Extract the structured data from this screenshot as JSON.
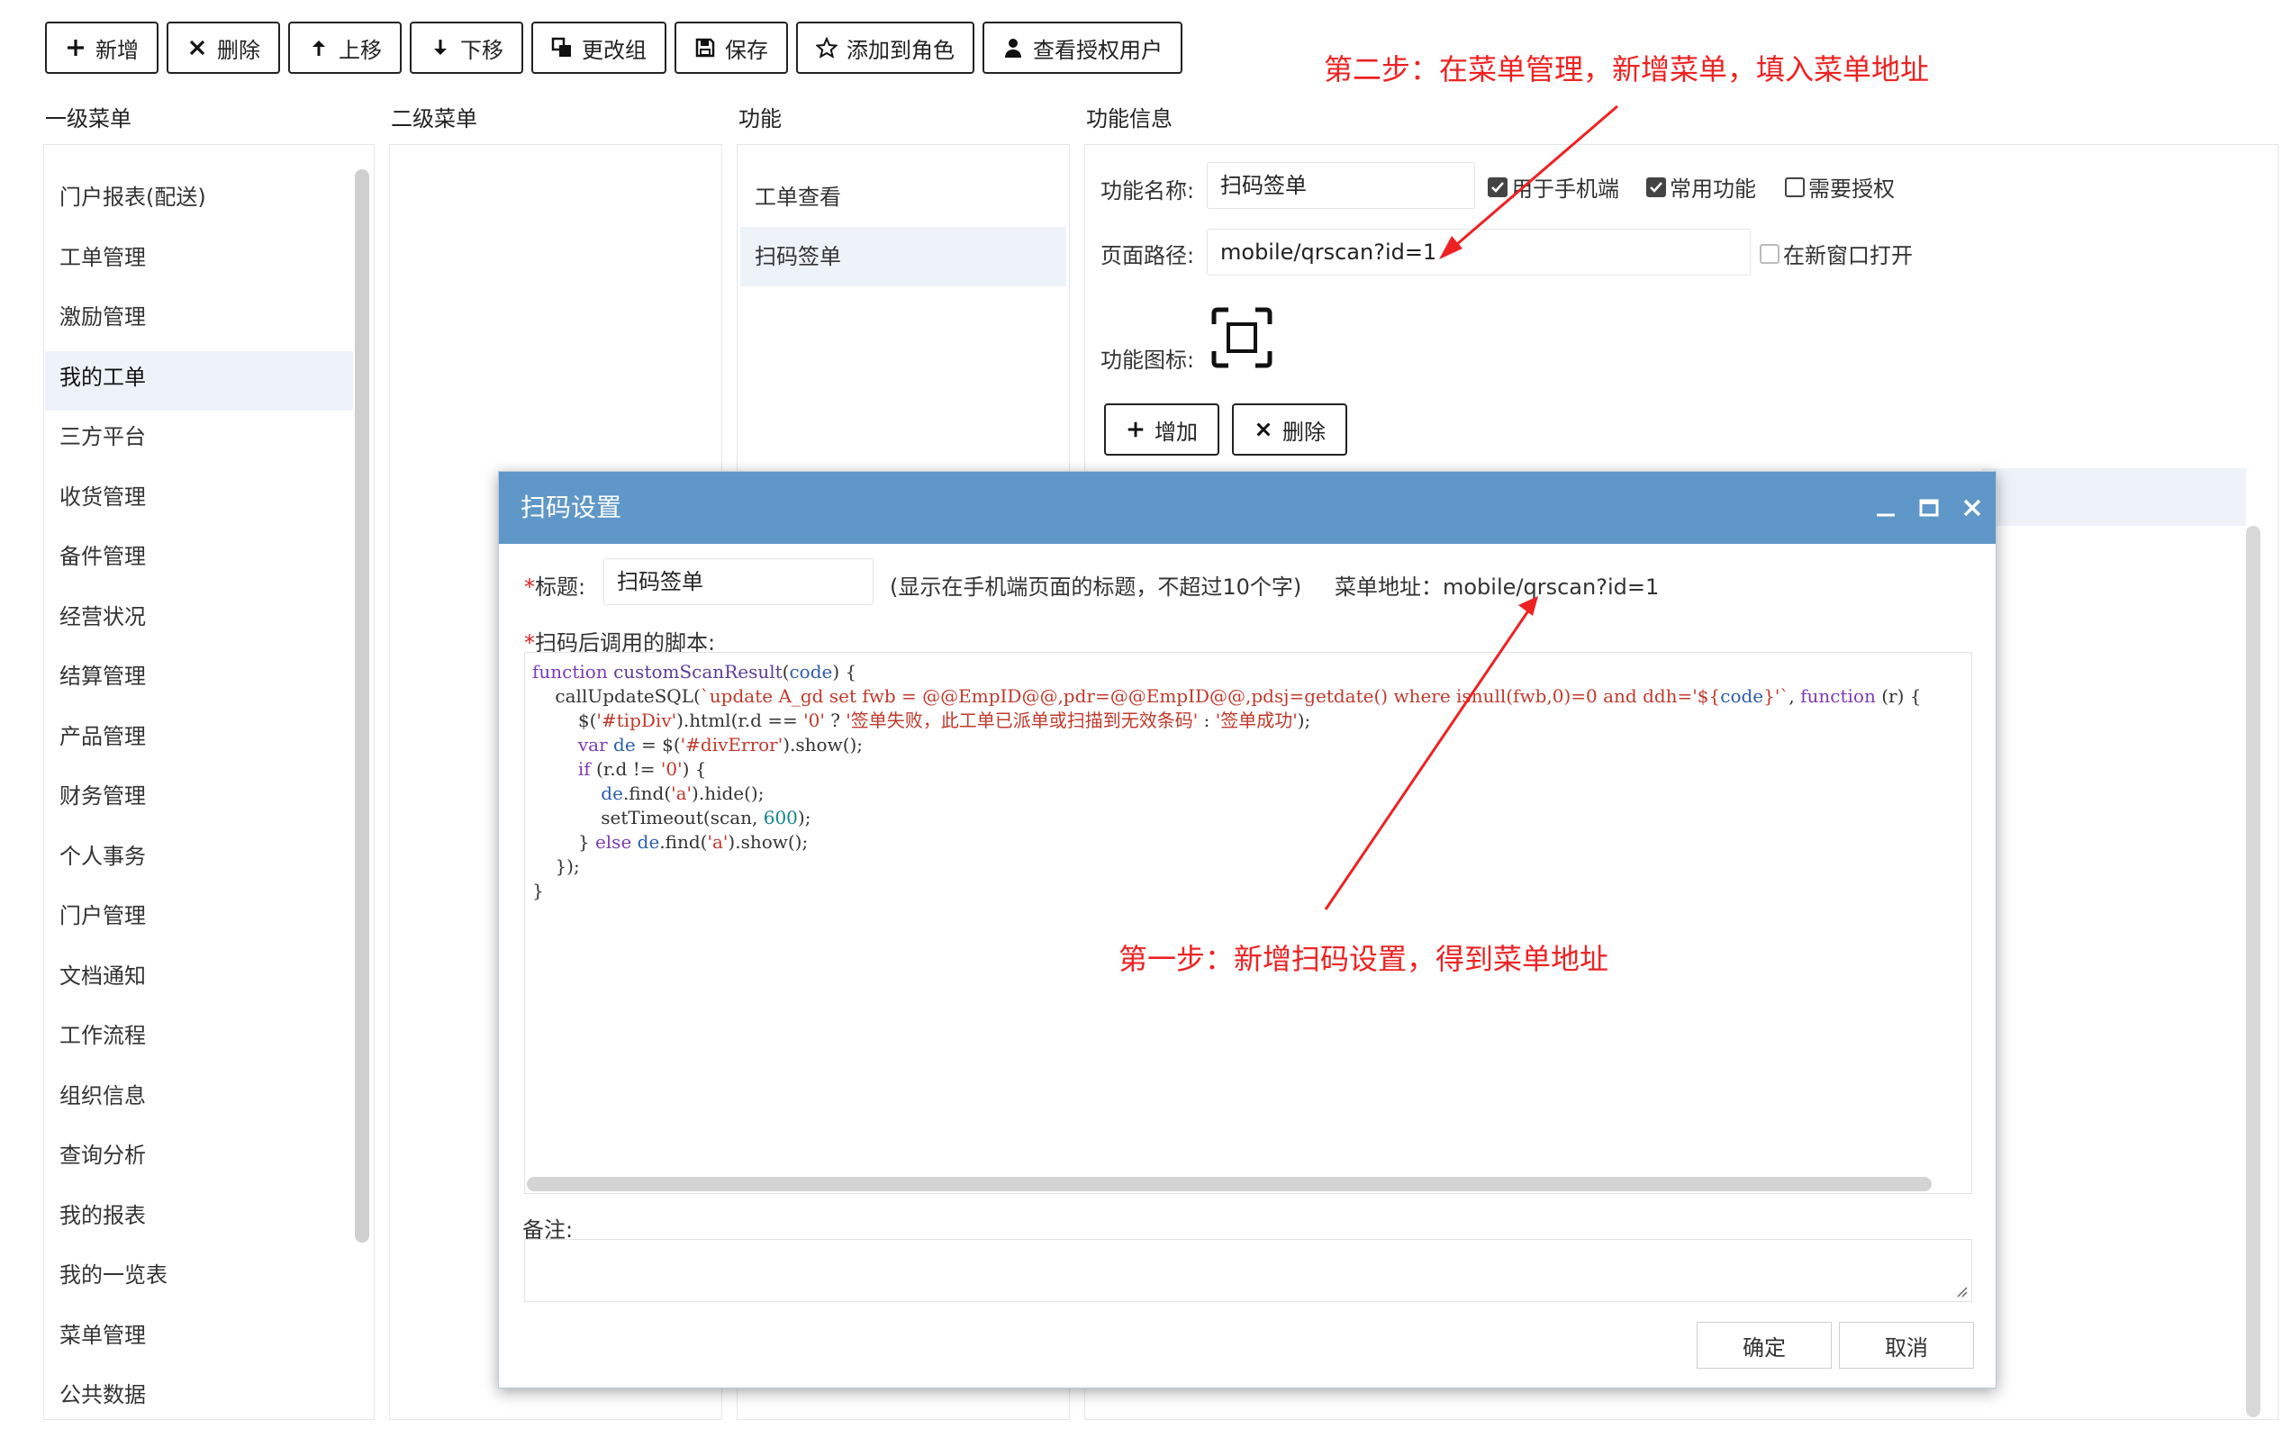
{
  "toolbar": {
    "add": "新增",
    "delete": "删除",
    "move_up": "上移",
    "move_down": "下移",
    "change_group": "更改组",
    "save": "保存",
    "add_to_role": "添加到角色",
    "view_users": "查看授权用户"
  },
  "columns": {
    "level1": "一级菜单",
    "level2": "二级菜单",
    "function": "功能",
    "function_info": "功能信息"
  },
  "level1_menu": [
    {
      "label": "门户报表(配送)"
    },
    {
      "label": "工单管理"
    },
    {
      "label": "激励管理"
    },
    {
      "label": "我的工单"
    },
    {
      "label": "三方平台"
    },
    {
      "label": "收货管理"
    },
    {
      "label": "备件管理"
    },
    {
      "label": "经营状况"
    },
    {
      "label": "结算管理"
    },
    {
      "label": "产品管理"
    },
    {
      "label": "财务管理"
    },
    {
      "label": "个人事务"
    },
    {
      "label": "门户管理"
    },
    {
      "label": "文档通知"
    },
    {
      "label": "工作流程"
    },
    {
      "label": "组织信息"
    },
    {
      "label": "查询分析"
    },
    {
      "label": "我的报表"
    },
    {
      "label": "我的一览表"
    },
    {
      "label": "菜单管理"
    },
    {
      "label": "公共数据"
    }
  ],
  "functions": [
    {
      "label": "工单查看"
    },
    {
      "label": "扫码签单"
    }
  ],
  "function_info": {
    "name_label": "功能名称:",
    "name_value": "扫码签单",
    "for_mobile": "用于手机端",
    "common_func": "常用功能",
    "need_auth": "需要授权",
    "path_label": "页面路径:",
    "path_value": "mobile/qrscan?id=1",
    "new_window": "在新窗口打开",
    "icon_label": "功能图标:",
    "add_btn": "增加",
    "del_btn": "删除"
  },
  "annotations": {
    "step2": "第二步：在菜单管理，新增菜单，填入菜单地址",
    "step1": "第一步：新增扫码设置，得到菜单地址"
  },
  "dialog": {
    "title": "扫码设置",
    "title_label": "标题:",
    "title_value": "扫码签单",
    "title_hint": "(显示在手机端页面的标题，不超过10个字)",
    "menu_addr": "菜单地址：mobile/qrscan?id=1",
    "script_label": "扫码后调用的脚本:",
    "remark_label": "备注:",
    "ok": "确定",
    "cancel": "取消"
  },
  "colors": {
    "dialog_header": "#5f97c8",
    "annotation": "#ee2222",
    "selected_row": "#eef3f9"
  }
}
